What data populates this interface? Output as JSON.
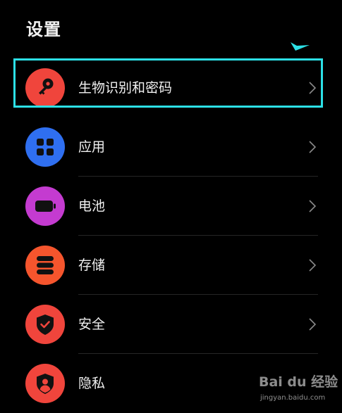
{
  "header": {
    "title": "设置"
  },
  "colors": {
    "highlight": "#2ce0e6",
    "biometric": "#f0453c",
    "apps": "#2f6ff0",
    "battery": "#c43bd0",
    "storage": "#f5552d",
    "security": "#f0453c",
    "privacy": "#f0453c"
  },
  "settings": {
    "items": [
      {
        "label": "生物识别和密码",
        "icon": "key-icon"
      },
      {
        "label": "应用",
        "icon": "grid-icon"
      },
      {
        "label": "电池",
        "icon": "battery-icon"
      },
      {
        "label": "存储",
        "icon": "storage-icon"
      },
      {
        "label": "安全",
        "icon": "shield-check-icon"
      },
      {
        "label": "隐私",
        "icon": "shield-person-icon"
      }
    ]
  },
  "watermark": {
    "logo": "Bai du 经验",
    "url": "jingyan.baidu.com"
  }
}
